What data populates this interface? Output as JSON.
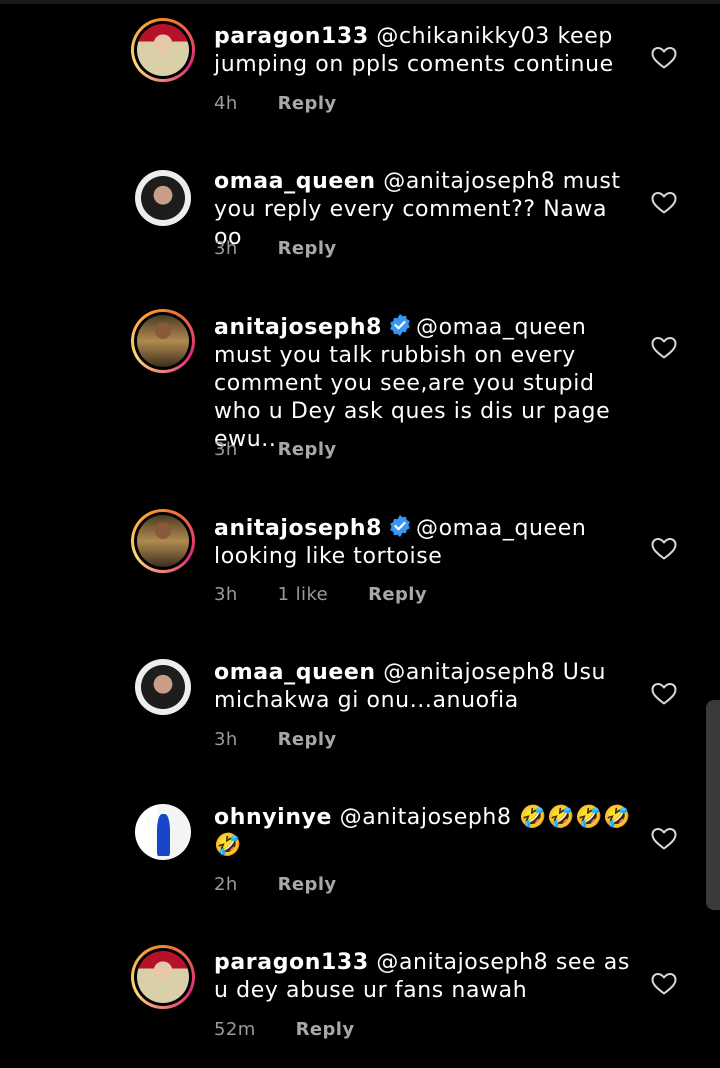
{
  "comments": [
    {
      "username": "paragon133",
      "verified": false,
      "mention": "@chikanikky03",
      "body": " keep jumping on ppls coments continue",
      "time": "4h",
      "likes": "",
      "reply": "Reply",
      "avatar": "paragon"
    },
    {
      "username": "omaa_queen",
      "verified": false,
      "mention": "@anitajoseph8",
      "body": " must you reply every comment?? Nawa oo",
      "time": "3h",
      "likes": "",
      "reply": "Reply",
      "avatar": "omaa"
    },
    {
      "username": "anitajoseph8",
      "verified": true,
      "mention": "@omaa_queen",
      "body": " must you talk rubbish on every comment you see,are you stupid who u Dey ask ques is dis ur page ewu..",
      "time": "3h",
      "likes": "",
      "reply": "Reply",
      "avatar": "anita"
    },
    {
      "username": "anitajoseph8",
      "verified": true,
      "mention": "@omaa_queen",
      "body": " looking like tortoise",
      "time": "3h",
      "likes": "1 like",
      "reply": "Reply",
      "avatar": "anita"
    },
    {
      "username": "omaa_queen",
      "verified": false,
      "mention": "@anitajoseph8",
      "body": " Usu michakwa gi onu...anuofia",
      "time": "3h",
      "likes": "",
      "reply": "Reply",
      "avatar": "omaa"
    },
    {
      "username": "ohnyinye",
      "verified": false,
      "mention": "@anitajoseph8",
      "body": " 🤣🤣🤣🤣🤣",
      "time": "2h",
      "likes": "",
      "reply": "Reply",
      "avatar": "ohnyinye"
    },
    {
      "username": "paragon133",
      "verified": false,
      "mention": "@anitajoseph8",
      "body": " see as u dey abuse ur fans nawah",
      "time": "52m",
      "likes": "",
      "reply": "Reply",
      "avatar": "paragon"
    }
  ],
  "colors": {
    "background": "#000000",
    "text": "#ffffff",
    "meta": "#9a9a9a",
    "verified": "#3897f0"
  },
  "icons": {
    "like": "heart-outline-icon",
    "verified": "verified-badge-icon"
  }
}
